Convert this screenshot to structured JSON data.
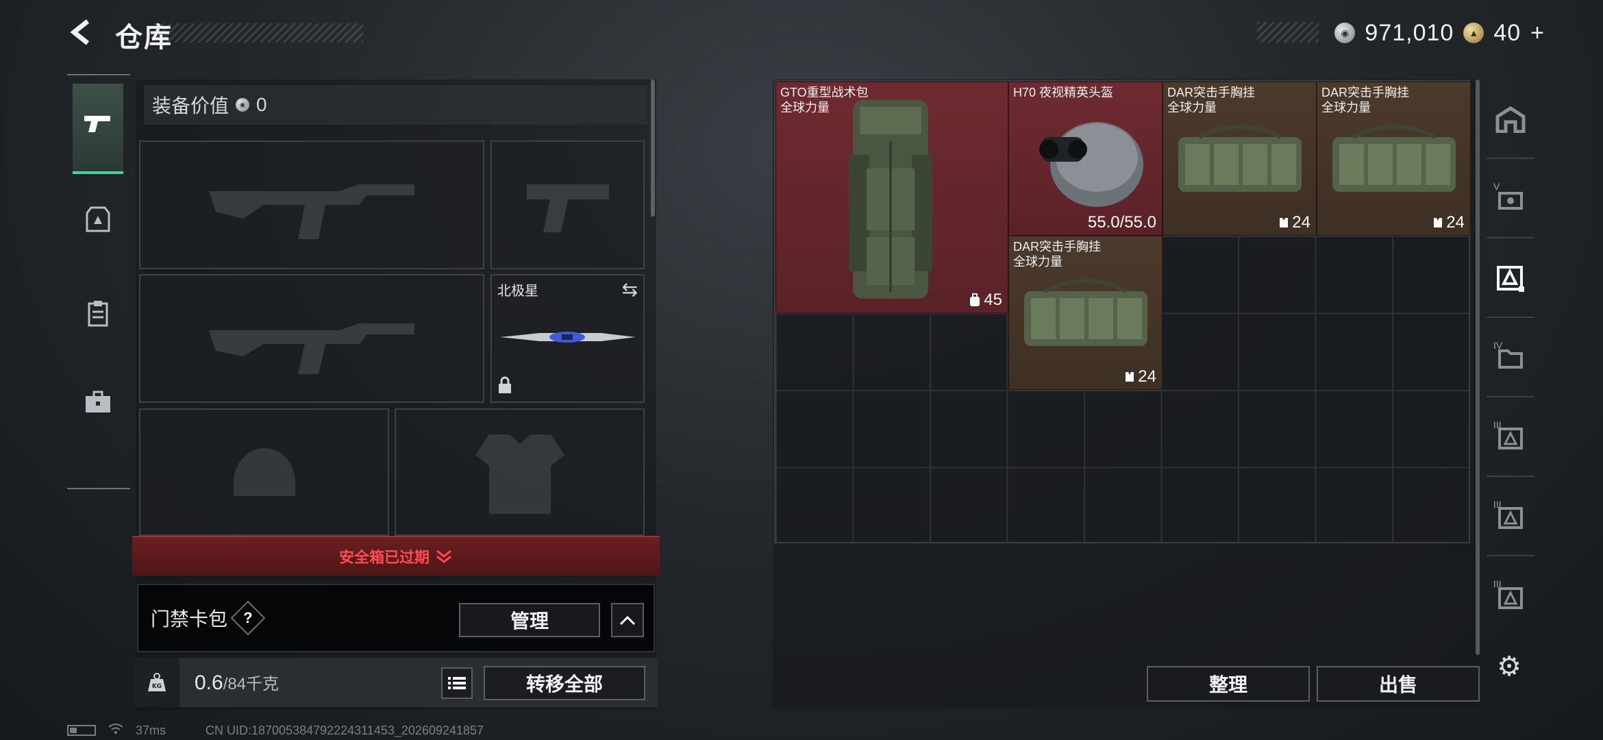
{
  "header": {
    "title": "仓库",
    "back_icon": "chevron-left-icon"
  },
  "currency": {
    "silver_value": "971,010",
    "gold_value": "40",
    "plus_label": "+"
  },
  "left_nav": {
    "items": [
      {
        "name": "weapons",
        "icon": "pistol-icon",
        "active": true
      },
      {
        "name": "armor",
        "icon": "armor-icon",
        "active": false
      },
      {
        "name": "clipboard",
        "icon": "clipboard-icon",
        "active": false
      },
      {
        "name": "case",
        "icon": "briefcase-icon",
        "active": false
      }
    ]
  },
  "equipment": {
    "value_label": "装备价值",
    "value": "0",
    "knife_name": "北极星"
  },
  "safe_box": {
    "status": "安全箱已过期"
  },
  "keycard": {
    "label": "门禁卡包",
    "help": "?",
    "manage_label": "管理",
    "expand_icon": "chevron-up-icon"
  },
  "weight": {
    "current": "0.6",
    "capacity": "/84千克",
    "transfer_label": "转移全部",
    "list_icon": "list-icon"
  },
  "storage": {
    "items": [
      {
        "name": "GTO重型战术包",
        "sub": "全球力量",
        "stat": "45",
        "stat_icon": "backpack-icon",
        "rarity": "red"
      },
      {
        "name": "H70 夜视精英头盔",
        "sub": "",
        "stat": "55.0/55.0",
        "stat_icon": "",
        "rarity": "red"
      },
      {
        "name": "DAR突击手胸挂",
        "sub": "全球力量",
        "stat": "24",
        "stat_icon": "vest-icon",
        "rarity": "brown"
      },
      {
        "name": "DAR突击手胸挂",
        "sub": "全球力量",
        "stat": "24",
        "stat_icon": "vest-icon",
        "rarity": "brown"
      },
      {
        "name": "DAR突击手胸挂",
        "sub": "全球力量",
        "stat": "24",
        "stat_icon": "vest-icon",
        "rarity": "brown"
      }
    ],
    "sort_label": "整理",
    "sell_label": "出售"
  },
  "right_nav": {
    "items": [
      {
        "icon": "home-icon",
        "level": ""
      },
      {
        "icon": "storage-v-icon",
        "level": "V"
      },
      {
        "icon": "storage-active-icon",
        "level": ""
      },
      {
        "icon": "storage-iv-icon",
        "level": "IV"
      },
      {
        "icon": "storage-iii-icon",
        "level": "III"
      },
      {
        "icon": "storage-iii-icon",
        "level": "III"
      },
      {
        "icon": "storage-iii-icon",
        "level": "III"
      }
    ]
  },
  "footer": {
    "ping": "37ms",
    "uid": "CN UID:187005384792224311453_202609241857"
  },
  "colors": {
    "accent": "#3fd6a0",
    "rarity_red": "#6e2a30",
    "rarity_brown": "#4c3a2c",
    "alert": "#ff4d4f"
  }
}
